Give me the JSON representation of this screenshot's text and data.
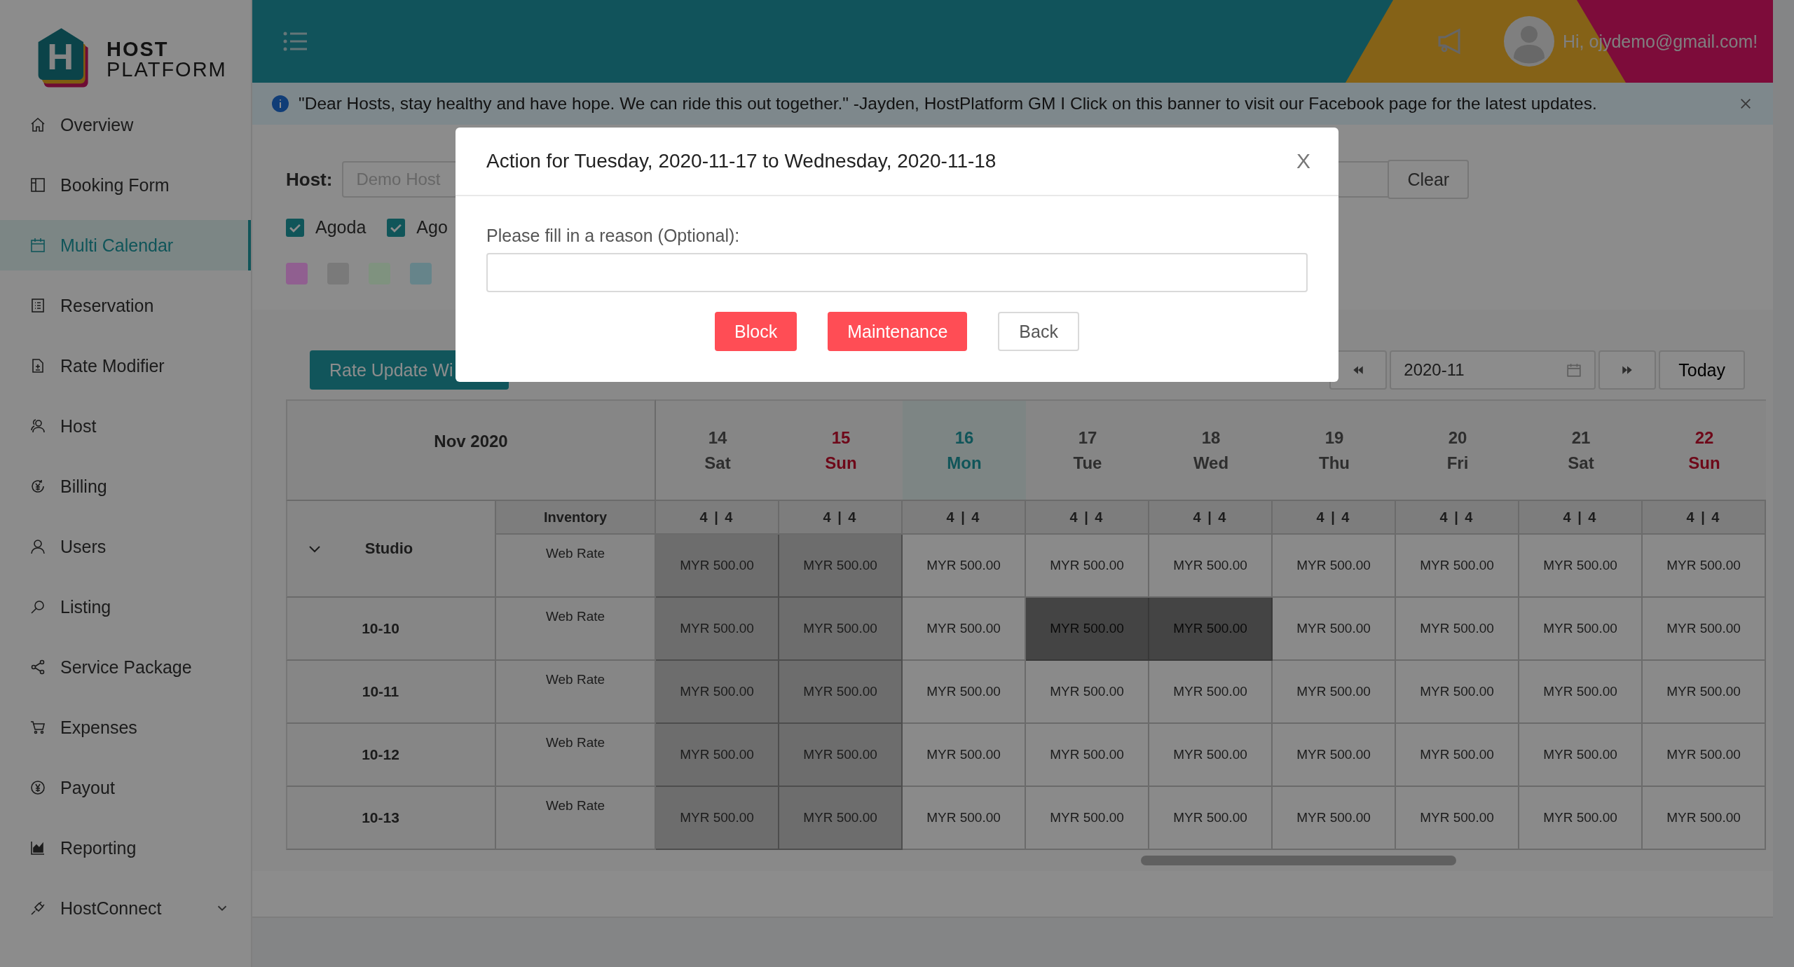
{
  "logo": {
    "mark": "H",
    "line1": "HOST",
    "line2": "PLATFORM"
  },
  "sidebar": {
    "items": [
      {
        "label": "Overview",
        "selected": false,
        "submenu": false
      },
      {
        "label": "Booking Form",
        "selected": false,
        "submenu": false
      },
      {
        "label": "Multi Calendar",
        "selected": true,
        "submenu": false
      },
      {
        "label": "Reservation",
        "selected": false,
        "submenu": false
      },
      {
        "label": "Rate Modifier",
        "selected": false,
        "submenu": false
      },
      {
        "label": "Host",
        "selected": false,
        "submenu": false
      },
      {
        "label": "Billing",
        "selected": false,
        "submenu": false
      },
      {
        "label": "Users",
        "selected": false,
        "submenu": false
      },
      {
        "label": "Listing",
        "selected": false,
        "submenu": false
      },
      {
        "label": "Service Package",
        "selected": false,
        "submenu": false
      },
      {
        "label": "Expenses",
        "selected": false,
        "submenu": false
      },
      {
        "label": "Payout",
        "selected": false,
        "submenu": false
      },
      {
        "label": "Reporting",
        "selected": false,
        "submenu": false
      },
      {
        "label": "HostConnect",
        "selected": false,
        "submenu": true
      }
    ]
  },
  "header": {
    "greeting": "Hi, ojydemo@gmail.com!"
  },
  "banner": {
    "text": "\"Dear Hosts, stay healthy and have hope. We can ride this out together.\" -Jayden, HostPlatform GM I Click on this banner to visit our Facebook page for the latest updates."
  },
  "filters": {
    "host_label": "Host:",
    "host_placeholder": "Demo Host",
    "clear_button": "Clear",
    "channels": [
      {
        "label": "Agoda",
        "checked": true
      },
      {
        "label": "Ago",
        "checked": true
      }
    ],
    "legend": [
      {
        "color": "#905f90"
      },
      {
        "color": "#7a7a7a"
      },
      {
        "color": "#7f927f"
      },
      {
        "color": "#66848a"
      }
    ]
  },
  "toolbar": {
    "wizard_button": "Rate Update Wi",
    "month": "2020-11",
    "today_button": "Today"
  },
  "table": {
    "month": "Nov 2020",
    "days": [
      {
        "date": "14",
        "weekday": "Sat",
        "kind": "weekday"
      },
      {
        "date": "15",
        "weekday": "Sun",
        "kind": "sunday"
      },
      {
        "date": "16",
        "weekday": "Mon",
        "kind": "today"
      },
      {
        "date": "17",
        "weekday": "Tue",
        "kind": "weekday"
      },
      {
        "date": "18",
        "weekday": "Wed",
        "kind": "weekday"
      },
      {
        "date": "19",
        "weekday": "Thu",
        "kind": "weekday"
      },
      {
        "date": "20",
        "weekday": "Fri",
        "kind": "weekday"
      },
      {
        "date": "21",
        "weekday": "Sat",
        "kind": "weekday"
      },
      {
        "date": "22",
        "weekday": "Sun",
        "kind": "sunday"
      }
    ],
    "rows": [
      {
        "kind": "group",
        "name": "Studio",
        "expanded": true,
        "inventory_label": "Inventory",
        "inventory": [
          "4 | 4",
          "4 | 4",
          "4 | 4",
          "4 | 4",
          "4 | 4",
          "4 | 4",
          "4 | 4",
          "4 | 4",
          "4 | 4"
        ],
        "rate_label": "Web Rate",
        "cells": [
          {
            "text": "MYR 500.00",
            "past": true,
            "selected": false
          },
          {
            "text": "MYR 500.00",
            "past": true,
            "selected": false
          },
          {
            "text": "MYR 500.00",
            "past": false,
            "selected": false
          },
          {
            "text": "MYR 500.00",
            "past": false,
            "selected": false
          },
          {
            "text": "MYR 500.00",
            "past": false,
            "selected": false
          },
          {
            "text": "MYR 500.00",
            "past": false,
            "selected": false
          },
          {
            "text": "MYR 500.00",
            "past": false,
            "selected": false
          },
          {
            "text": "MYR 500.00",
            "past": false,
            "selected": false
          },
          {
            "text": "MYR 500.00",
            "past": false,
            "selected": false
          }
        ]
      },
      {
        "kind": "unit",
        "name": "10-10",
        "rate_label": "Web Rate",
        "cells": [
          {
            "text": "MYR 500.00",
            "past": true,
            "selected": false
          },
          {
            "text": "MYR 500.00",
            "past": true,
            "selected": false
          },
          {
            "text": "MYR 500.00",
            "past": false,
            "selected": false
          },
          {
            "text": "MYR 500.00",
            "past": false,
            "selected": true
          },
          {
            "text": "MYR 500.00",
            "past": false,
            "selected": true
          },
          {
            "text": "MYR 500.00",
            "past": false,
            "selected": false
          },
          {
            "text": "MYR 500.00",
            "past": false,
            "selected": false
          },
          {
            "text": "MYR 500.00",
            "past": false,
            "selected": false
          },
          {
            "text": "MYR 500.00",
            "past": false,
            "selected": false
          }
        ]
      },
      {
        "kind": "unit",
        "name": "10-11",
        "rate_label": "Web Rate",
        "cells": [
          {
            "text": "MYR 500.00",
            "past": true,
            "selected": false
          },
          {
            "text": "MYR 500.00",
            "past": true,
            "selected": false
          },
          {
            "text": "MYR 500.00",
            "past": false,
            "selected": false
          },
          {
            "text": "MYR 500.00",
            "past": false,
            "selected": false
          },
          {
            "text": "MYR 500.00",
            "past": false,
            "selected": false
          },
          {
            "text": "MYR 500.00",
            "past": false,
            "selected": false
          },
          {
            "text": "MYR 500.00",
            "past": false,
            "selected": false
          },
          {
            "text": "MYR 500.00",
            "past": false,
            "selected": false
          },
          {
            "text": "MYR 500.00",
            "past": false,
            "selected": false
          }
        ]
      },
      {
        "kind": "unit",
        "name": "10-12",
        "rate_label": "Web Rate",
        "cells": [
          {
            "text": "MYR 500.00",
            "past": true,
            "selected": false
          },
          {
            "text": "MYR 500.00",
            "past": true,
            "selected": false
          },
          {
            "text": "MYR 500.00",
            "past": false,
            "selected": false
          },
          {
            "text": "MYR 500.00",
            "past": false,
            "selected": false
          },
          {
            "text": "MYR 500.00",
            "past": false,
            "selected": false
          },
          {
            "text": "MYR 500.00",
            "past": false,
            "selected": false
          },
          {
            "text": "MYR 500.00",
            "past": false,
            "selected": false
          },
          {
            "text": "MYR 500.00",
            "past": false,
            "selected": false
          },
          {
            "text": "MYR 500.00",
            "past": false,
            "selected": false
          }
        ]
      },
      {
        "kind": "unit",
        "name": "10-13",
        "rate_label": "Web Rate",
        "cells": [
          {
            "text": "MYR 500.00",
            "past": true,
            "selected": false
          },
          {
            "text": "MYR 500.00",
            "past": true,
            "selected": false
          },
          {
            "text": "MYR 500.00",
            "past": false,
            "selected": false
          },
          {
            "text": "MYR 500.00",
            "past": false,
            "selected": false
          },
          {
            "text": "MYR 500.00",
            "past": false,
            "selected": false
          },
          {
            "text": "MYR 500.00",
            "past": false,
            "selected": false
          },
          {
            "text": "MYR 500.00",
            "past": false,
            "selected": false
          },
          {
            "text": "MYR 500.00",
            "past": false,
            "selected": false
          },
          {
            "text": "MYR 500.00",
            "past": false,
            "selected": false
          }
        ]
      }
    ]
  },
  "modal": {
    "title": "Action for Tuesday, 2020-11-17 to Wednesday, 2020-11-18",
    "close": "X",
    "field_label": "Please fill in a reason (Optional):",
    "buttons": [
      {
        "label": "Block",
        "kind": "danger"
      },
      {
        "label": "Maintenance",
        "kind": "danger"
      },
      {
        "label": "Back",
        "kind": "default"
      }
    ]
  }
}
